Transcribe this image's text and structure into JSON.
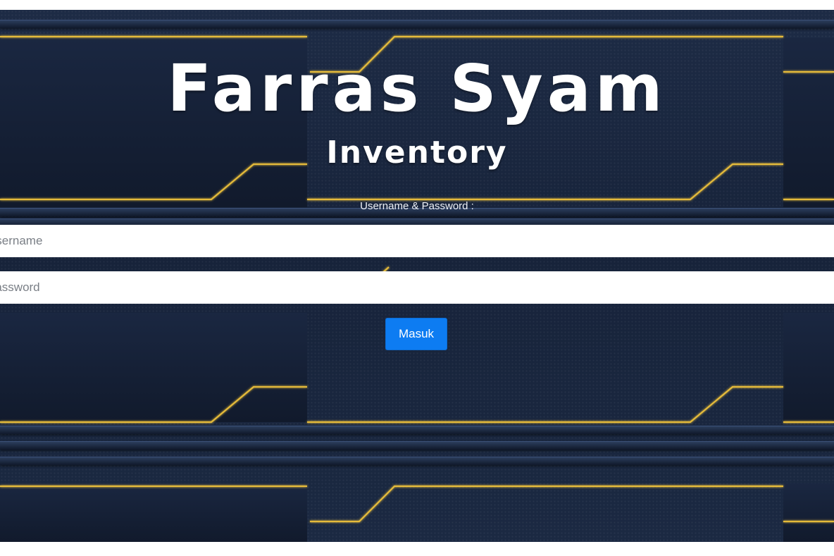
{
  "header": {
    "title": "Farras Syam",
    "subtitle": "Inventory"
  },
  "login_form": {
    "label": "Username & Password :",
    "username": {
      "placeholder": "Username",
      "value": ""
    },
    "password": {
      "placeholder": "Password",
      "value": ""
    },
    "submit_label": "Masuk"
  },
  "colors": {
    "background": "#17233a",
    "accent_gold": "#f0c33a",
    "button": "#0d7cf2",
    "text": "#ffffff"
  }
}
